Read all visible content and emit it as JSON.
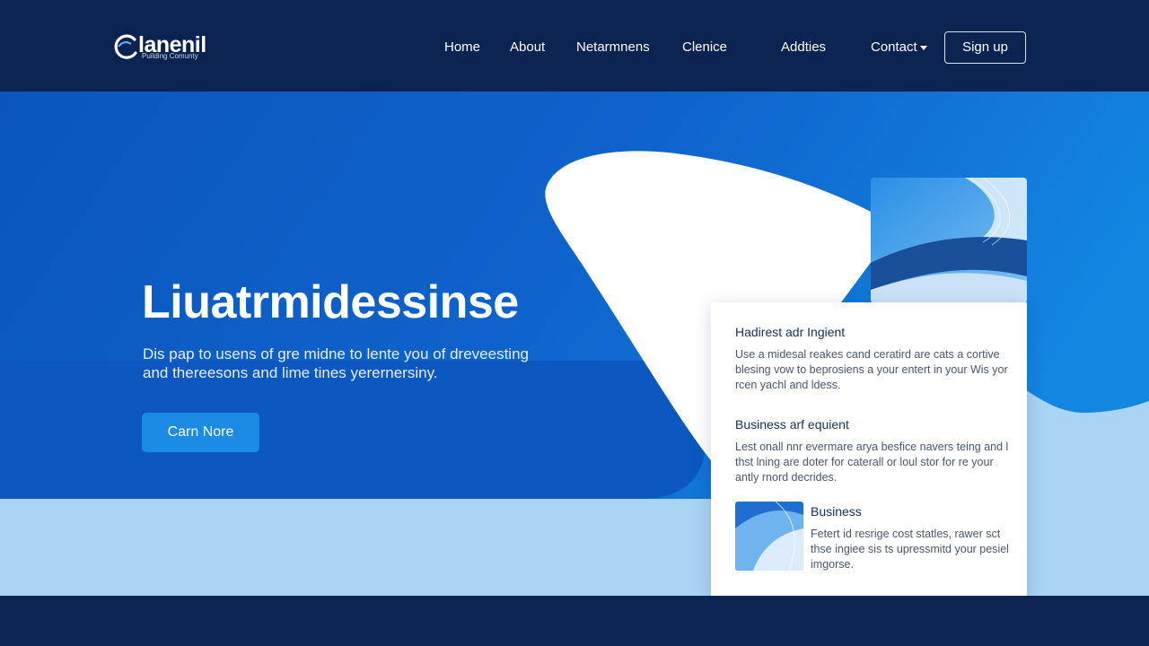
{
  "brand": {
    "name": "lanenil",
    "tagline": "Puilding Comunty"
  },
  "nav": {
    "items": [
      "Home",
      "About",
      "Netarmnens",
      "Clenice",
      "Addties",
      "Contact"
    ],
    "signup_label": "Sign up"
  },
  "hero": {
    "title": "Liuatrmidessinse",
    "description": "Dis pap to usens of gre midne to lente you of dreveesting and thereesons and lime tines yerernersiny.",
    "cta_label": "Carn Nore"
  },
  "card": {
    "sections": [
      {
        "heading": "Hadirest adr Ingient",
        "text": "Use a midesal reakes cand ceratird are cats a cortive blesing vow to beprosiens a your entert in your Wis yor rcen yachl and ldess."
      },
      {
        "heading": "Business arf equient",
        "text": "Lest onall nnr evermare arya besfice navers teing and l thst lning are doter for caterall or loul stor for re your antly rnord decrides."
      },
      {
        "heading": "Business",
        "text": "Fetert id resrige cost statles, rawer sct thse ingiee sis ts upressmitd your pesiel imgorse."
      }
    ]
  },
  "colors": {
    "header_bg": "#0b2350",
    "hero_blue": "#0d5fc4",
    "light_blue": "#a9d4f4",
    "cta_blue": "#1b8be6",
    "card_heading": "#14305e"
  }
}
